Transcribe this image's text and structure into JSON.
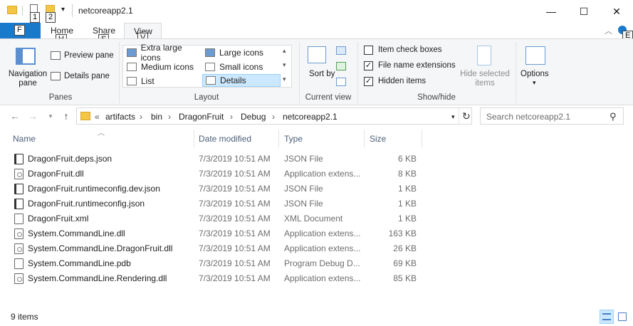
{
  "window": {
    "title": "netcoreapp2.1",
    "qa_keytips": [
      "1",
      "2"
    ],
    "controls": {
      "minimize": "—",
      "maximize": "☐",
      "close": "✕"
    }
  },
  "ribbon_tabs": {
    "file": {
      "label": "F"
    },
    "home": {
      "label": "Home",
      "keytip": "H"
    },
    "share": {
      "label": "Share",
      "keytip": "S"
    },
    "view": {
      "label": "View",
      "keytip": "V"
    },
    "help_keytip": "E"
  },
  "ribbon": {
    "panes": {
      "navigation_pane": "Navigation pane",
      "preview_pane": "Preview pane",
      "details_pane": "Details pane",
      "label": "Panes"
    },
    "layout": {
      "items": [
        "Extra large icons",
        "Large icons",
        "Medium icons",
        "Small icons",
        "List",
        "Details"
      ],
      "selected": "Details",
      "label": "Layout"
    },
    "current_view": {
      "sort_by": "Sort by",
      "label": "Current view"
    },
    "show_hide": {
      "item_check_boxes": "Item check boxes",
      "file_name_extensions": "File name extensions",
      "hidden_items": "Hidden items",
      "hide_selected": "Hide selected items",
      "label": "Show/hide",
      "checked": {
        "item_check_boxes": false,
        "file_name_extensions": true,
        "hidden_items": true
      }
    },
    "options": {
      "label": "Options"
    }
  },
  "address_bar": {
    "prefix": "«",
    "crumbs": [
      "artifacts",
      "bin",
      "DragonFruit",
      "Debug",
      "netcoreapp2.1"
    ],
    "search_placeholder": "Search netcoreapp2.1"
  },
  "columns": [
    "Name",
    "Date modified",
    "Type",
    "Size"
  ],
  "files": [
    {
      "name": "DragonFruit.deps.json",
      "date": "7/3/2019 10:51 AM",
      "type": "JSON File",
      "size": "6 KB",
      "icon": "json-file-icon"
    },
    {
      "name": "DragonFruit.dll",
      "date": "7/3/2019 10:51 AM",
      "type": "Application extens...",
      "size": "8 KB",
      "icon": "dll-file-icon"
    },
    {
      "name": "DragonFruit.runtimeconfig.dev.json",
      "date": "7/3/2019 10:51 AM",
      "type": "JSON File",
      "size": "1 KB",
      "icon": "json-file-icon"
    },
    {
      "name": "DragonFruit.runtimeconfig.json",
      "date": "7/3/2019 10:51 AM",
      "type": "JSON File",
      "size": "1 KB",
      "icon": "json-file-icon"
    },
    {
      "name": "DragonFruit.xml",
      "date": "7/3/2019 10:51 AM",
      "type": "XML Document",
      "size": "1 KB",
      "icon": "xml-file-icon"
    },
    {
      "name": "System.CommandLine.dll",
      "date": "7/3/2019 10:51 AM",
      "type": "Application extens...",
      "size": "163 KB",
      "icon": "dll-file-icon"
    },
    {
      "name": "System.CommandLine.DragonFruit.dll",
      "date": "7/3/2019 10:51 AM",
      "type": "Application extens...",
      "size": "26 KB",
      "icon": "dll-file-icon"
    },
    {
      "name": "System.CommandLine.pdb",
      "date": "7/3/2019 10:51 AM",
      "type": "Program Debug D...",
      "size": "69 KB",
      "icon": "pdb-file-icon"
    },
    {
      "name": "System.CommandLine.Rendering.dll",
      "date": "7/3/2019 10:51 AM",
      "type": "Application extens...",
      "size": "85 KB",
      "icon": "dll-file-icon"
    }
  ],
  "status": {
    "item_count": "9 items"
  }
}
